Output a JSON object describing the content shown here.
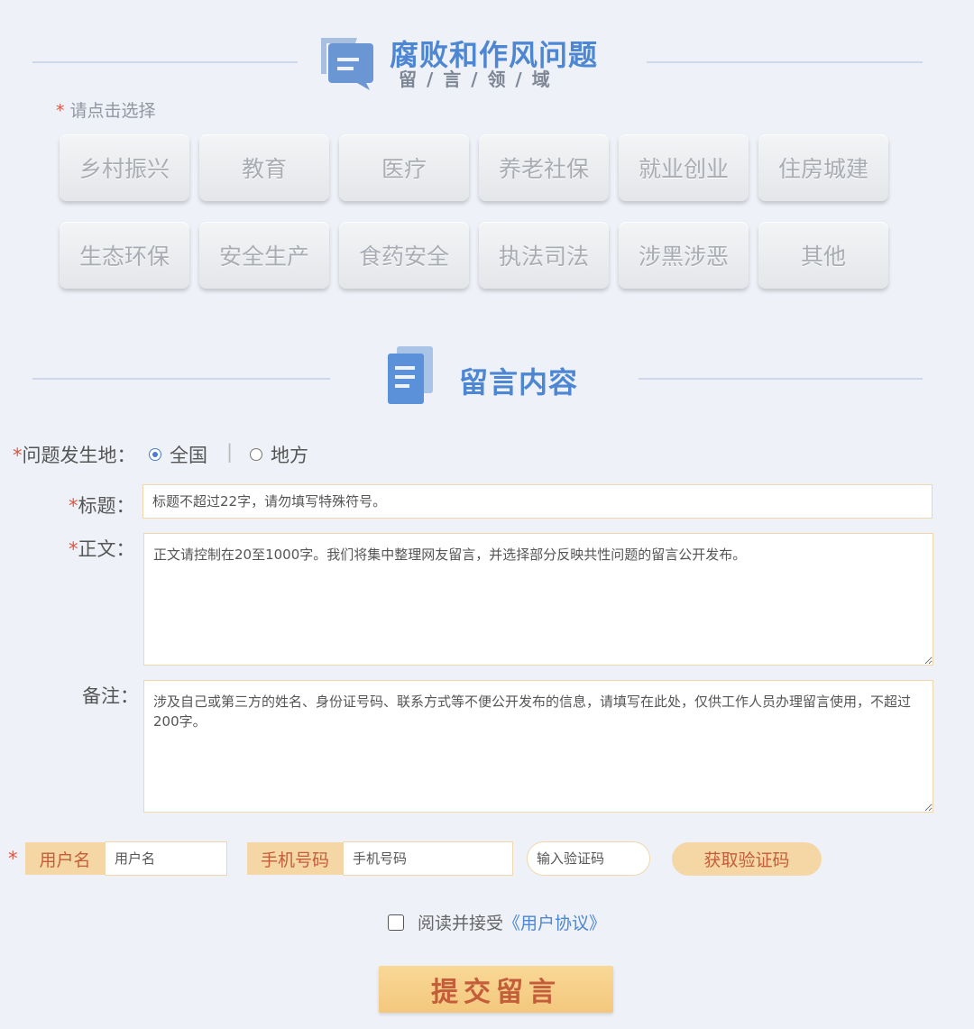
{
  "section1": {
    "title": "腐败和作风问题",
    "subtitle": "留 / 言 / 领 / 域"
  },
  "hint": "请点击选择",
  "categories": [
    "乡村振兴",
    "教育",
    "医疗",
    "养老社保",
    "就业创业",
    "住房城建",
    "生态环保",
    "安全生产",
    "食药安全",
    "执法司法",
    "涉黑涉恶",
    "其他"
  ],
  "section2": {
    "title": "留言内容"
  },
  "form": {
    "location_label": "问题发生地：",
    "location_national": "全国",
    "location_local": "地方",
    "title_label": "标题：",
    "title_placeholder": "标题不超过22字，请勿填写特殊符号。",
    "body_label": "正文：",
    "body_placeholder": "正文请控制在20至1000字。我们将集中整理网友留言，并选择部分反映共性问题的留言公开发布。",
    "remark_label": "备注：",
    "remark_placeholder": "涉及自己或第三方的姓名、身份证号码、联系方式等不便公开发布的信息，请填写在此处，仅供工作人员办理留言使用，不超过200字。",
    "username_tag": "用户名",
    "username_placeholder": "用户名",
    "phone_tag": "手机号码",
    "phone_placeholder": "手机号码",
    "code_placeholder": "输入验证码",
    "get_code_button": "获取验证码",
    "agree_text": "阅读并接受",
    "agreement_link": "《用户协议》",
    "submit_button": "提交留言"
  },
  "colors": {
    "accent_blue": "#4d86d2",
    "button_orange": "#f5d7a5",
    "text_orange": "#c45d3a",
    "required_red": "#e0553f"
  }
}
